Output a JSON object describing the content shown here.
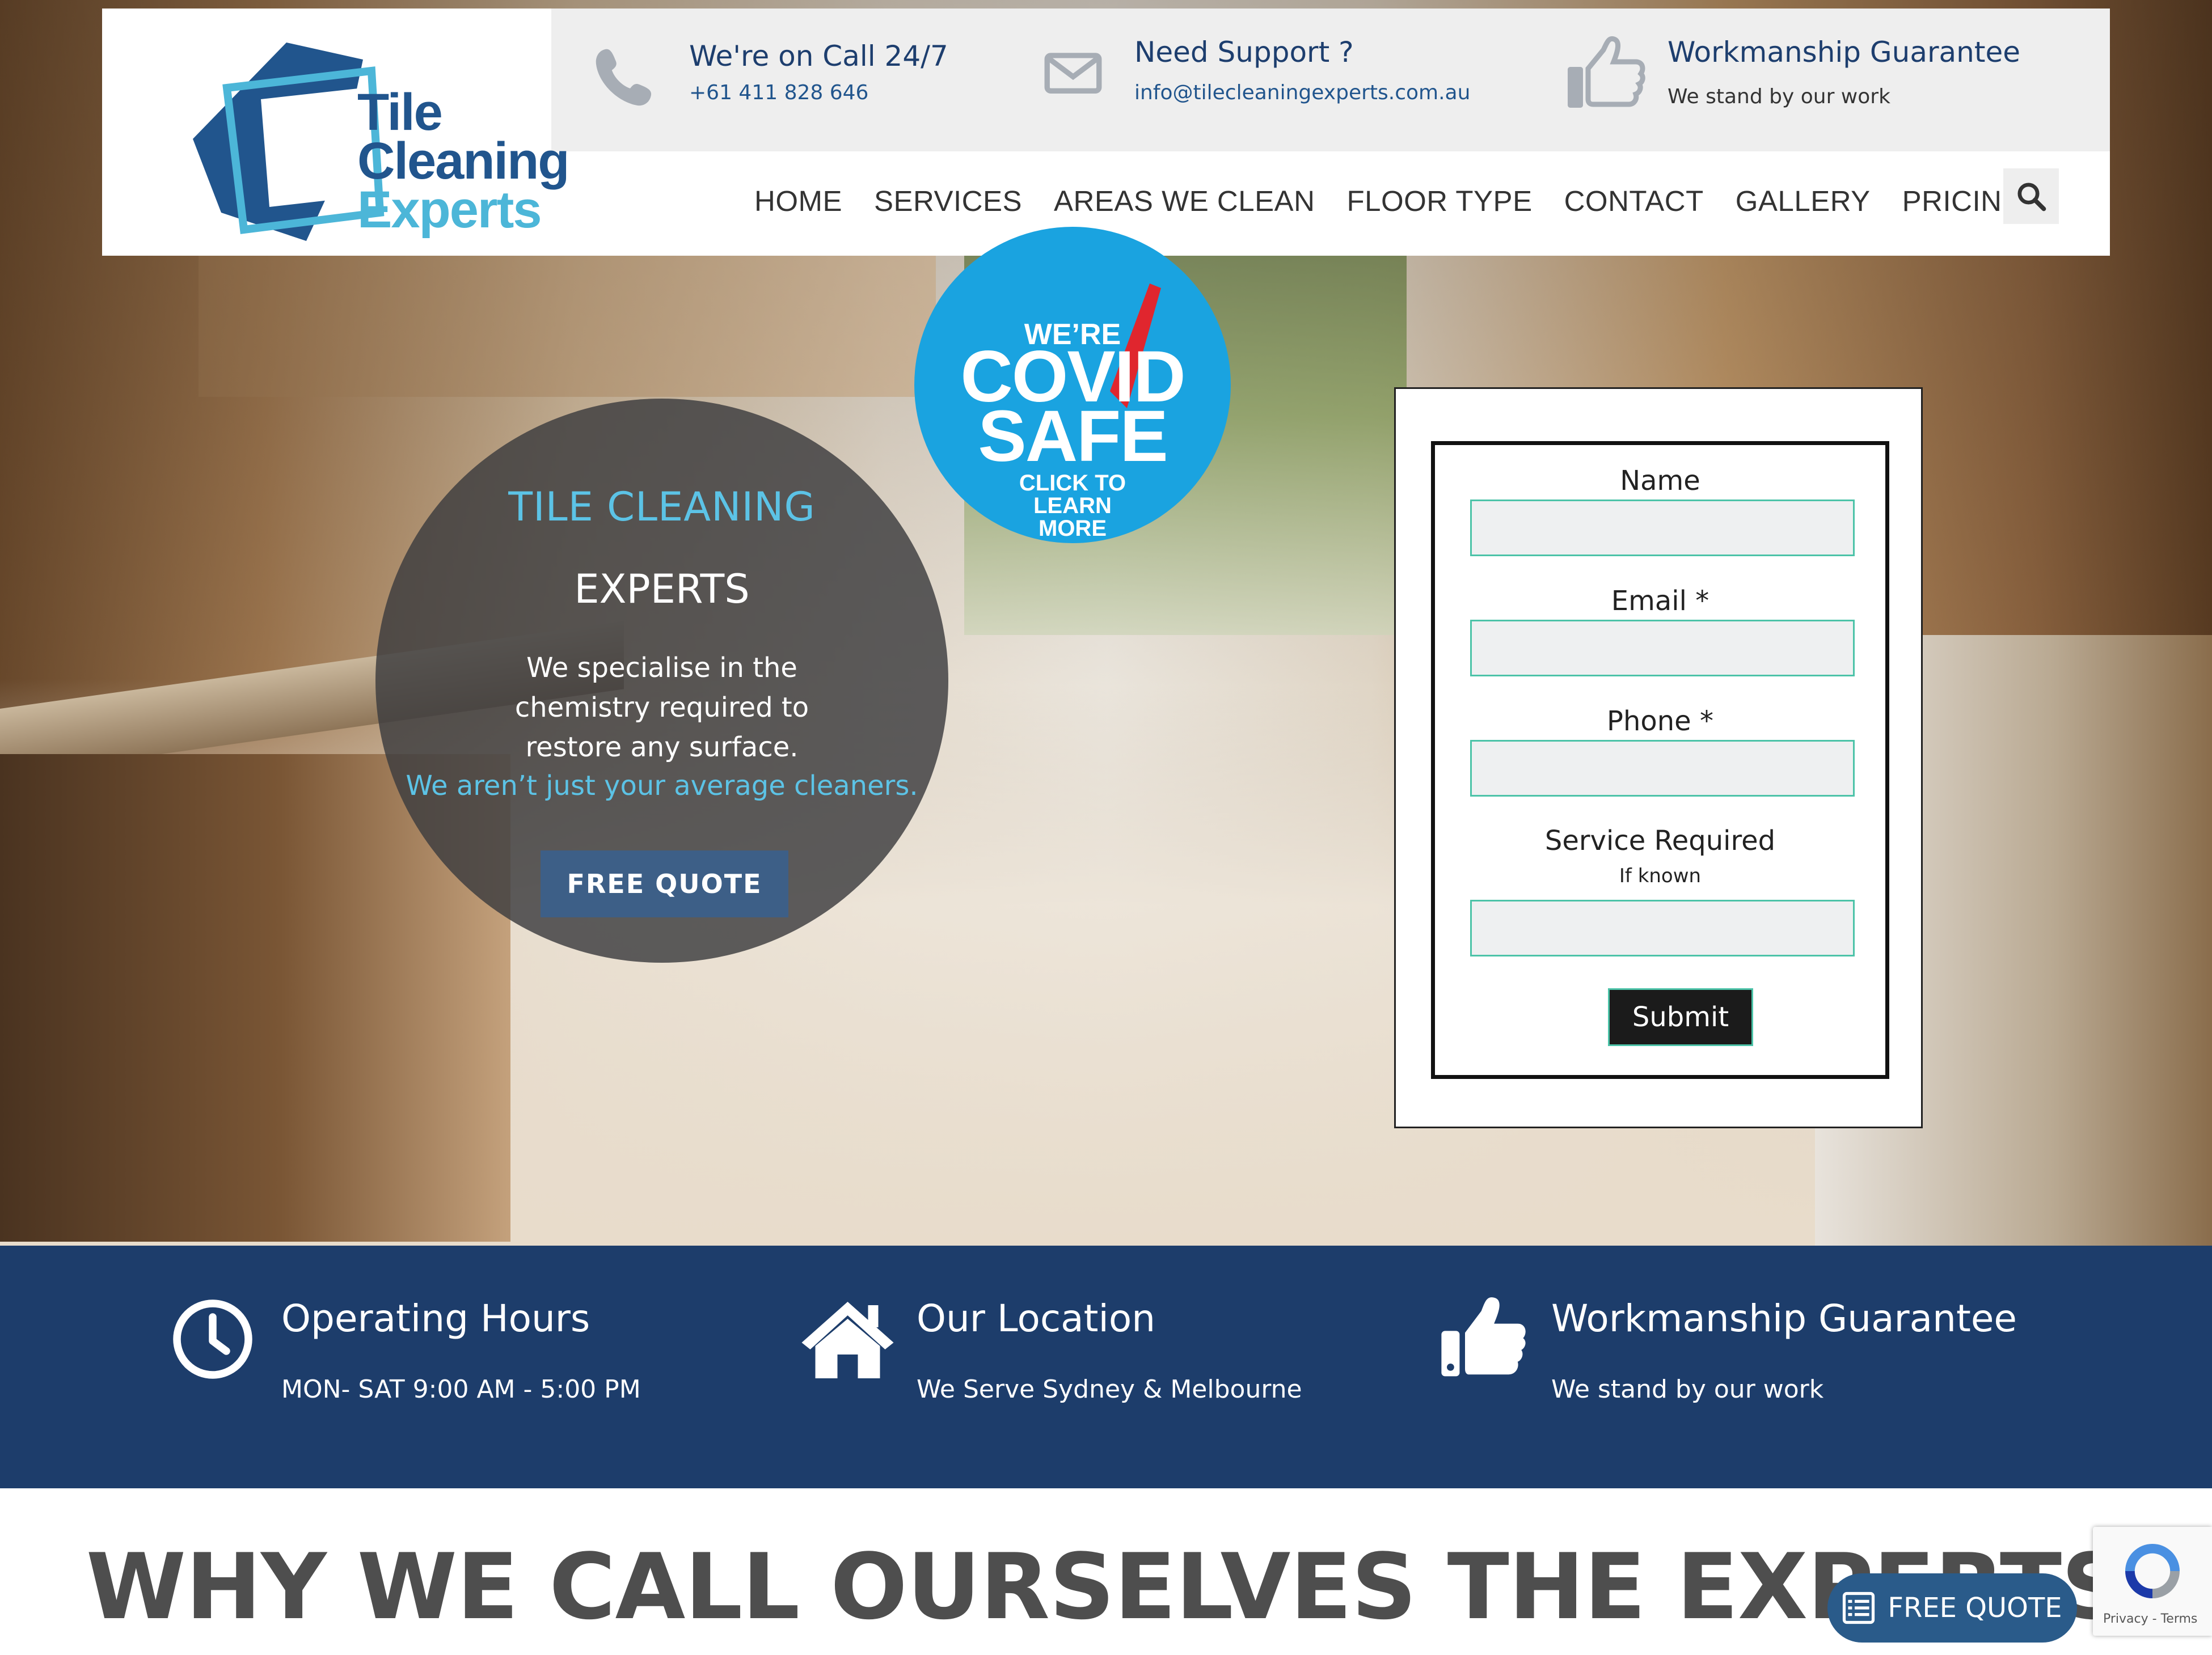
{
  "colors": {
    "brand_dark": "#21558d",
    "brand_light": "#4cb6d8",
    "band_bg": "#1d3d6b",
    "accent_cyan": "#5cc3e6",
    "input_border": "#4cc3a8"
  },
  "header": {
    "logo": {
      "line1": "Tile",
      "line2": "Cleaning",
      "line3": "Experts"
    },
    "call": {
      "icon": "phone-icon",
      "title": "We're on Call 24/7",
      "value": "+61 411 828 646"
    },
    "support": {
      "icon": "envelope-icon",
      "title": "Need Support ?",
      "value": "info@tilecleaningexperts.com.au"
    },
    "guarantee": {
      "icon": "thumbs-up-icon",
      "title": "Workmanship Guarantee",
      "value": "We stand by our work"
    }
  },
  "nav": {
    "items": [
      "HOME",
      "SERVICES",
      "AREAS WE CLEAN",
      "FLOOR TYPE",
      "CONTACT",
      "GALLERY",
      "PRICING"
    ],
    "search_icon": "search-icon"
  },
  "hero": {
    "title1": "TILE CLEANING",
    "title2": "EXPERTS",
    "text": "We specialise in the chemistry required to restore any surface.",
    "accent": "We aren’t just your average cleaners.",
    "button": "FREE QUOTE"
  },
  "covid": {
    "line1": "WE’RE",
    "line2": "COVID",
    "line3": "SAFE",
    "cta1": "CLICK TO",
    "cta2": "LEARN",
    "cta3": "MORE"
  },
  "form": {
    "name_label": "Name",
    "email_label": "Email *",
    "phone_label": "Phone *",
    "service_label": "Service Required",
    "service_hint": "If known",
    "name_value": "",
    "email_value": "",
    "phone_value": "",
    "service_value": "",
    "submit": "Submit"
  },
  "band": {
    "hours": {
      "icon": "clock-icon",
      "title": "Operating Hours",
      "text": "MON- SAT 9:00 AM - 5:00 PM"
    },
    "location": {
      "icon": "home-icon",
      "title": "Our Location",
      "text": "We Serve Sydney & Melbourne"
    },
    "guarantee": {
      "icon": "thumbs-up-icon",
      "title": "Workmanship Guarantee",
      "text": "We stand by our work"
    }
  },
  "section": {
    "heading": "WHY WE CALL OURSELVES THE EXPERTS"
  },
  "floating": {
    "label": "FREE QUOTE",
    "icon": "list-icon"
  },
  "recaptcha": {
    "links": "Privacy - Terms"
  }
}
